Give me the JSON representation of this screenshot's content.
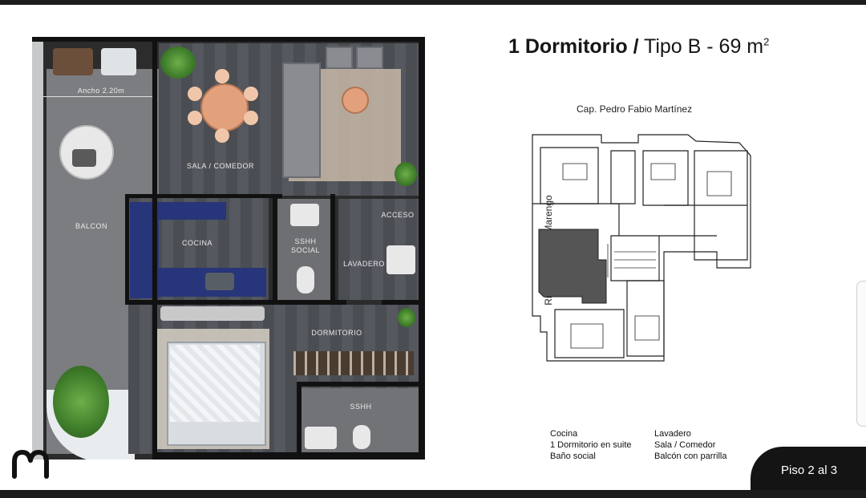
{
  "title": {
    "bold": "1 Dormitorio /",
    "regular": " Tipo B - 69 m",
    "superscript": "2"
  },
  "plan": {
    "dimension_label": "Ancho 2.20m",
    "rooms": {
      "sala_comedor": "SALA / COMEDOR",
      "balcon": "BALCON",
      "cocina": "COCINA",
      "sshh_social": "SSHH\nSOCIAL",
      "acceso": "ACCESO",
      "lavadero": "LAVADERO",
      "dormitorio": "DORMITORIO",
      "sshh": "SSHH"
    }
  },
  "key_plan": {
    "street_top": "Cap. Pedro Fabio Martínez",
    "street_left": "Ricardo Marrero Marengo"
  },
  "features": {
    "col1": [
      "Cocina",
      "1 Dormitorio en suite",
      "Baño social"
    ],
    "col2": [
      "Lavadero",
      "Sala / Comedor",
      "Balcón con parrilla"
    ]
  },
  "floor_badge": "Piso 2 al 3",
  "colors": {
    "accent_dark": "#141414",
    "highlight_unit": "#555555",
    "kitchen_counter": "#27357a"
  },
  "icons": [
    "brand-logo-icon"
  ]
}
